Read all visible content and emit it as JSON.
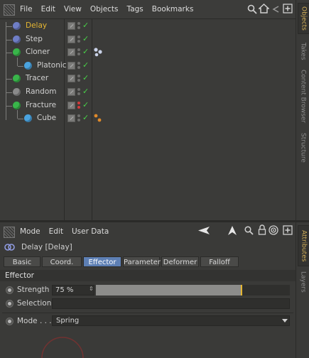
{
  "menubar": {
    "items": [
      "File",
      "Edit",
      "View",
      "Objects",
      "Tags",
      "Bookmarks"
    ]
  },
  "objects": [
    {
      "name": "Delay",
      "selected": true,
      "icon": "delay-effector-icon",
      "icon_color": "#6f7ec6",
      "depth": 0
    },
    {
      "name": "Step",
      "selected": false,
      "icon": "step-effector-icon",
      "icon_color": "#6f7ec6",
      "depth": 0
    },
    {
      "name": "Cloner",
      "selected": false,
      "icon": "cloner-icon",
      "icon_color": "#39b54a",
      "depth": 0
    },
    {
      "name": "Platonic",
      "selected": false,
      "icon": "platonic-icon",
      "icon_color": "#4aa3df",
      "depth": 1
    },
    {
      "name": "Tracer",
      "selected": false,
      "icon": "tracer-icon",
      "icon_color": "#39b54a",
      "depth": 0
    },
    {
      "name": "Random",
      "selected": false,
      "icon": "random-effector-icon",
      "icon_color": "#8a8a8a",
      "depth": 0
    },
    {
      "name": "Fracture",
      "selected": false,
      "icon": "fracture-icon",
      "icon_color": "#39b54a",
      "depth": 0
    },
    {
      "name": "Cube",
      "selected": false,
      "icon": "cube-icon",
      "icon_color": "#4aa3df",
      "depth": 1
    }
  ],
  "side_tabs_top": [
    "Objects",
    "Takes",
    "Content Browser",
    "Structure"
  ],
  "side_tabs_bottom": [
    "Attributes",
    "Layers"
  ],
  "attributes": {
    "menu": [
      "Mode",
      "Edit",
      "User Data"
    ],
    "title": "Delay [Delay]",
    "tabs": [
      "Basic",
      "Coord.",
      "Effector",
      "Parameter",
      "Deformer",
      "Falloff"
    ],
    "active_tab": "Effector",
    "section": "Effector",
    "strength_label": "Strength",
    "strength_value": "75 %",
    "strength_fraction": 0.75,
    "selection_label": "Selection",
    "selection_value": "",
    "mode_label": "Mode . . .",
    "mode_value": "Spring"
  },
  "colors": {
    "accent_selected": "#e5b632",
    "active_tab": "#5d7fb4",
    "check": "#48d048"
  }
}
